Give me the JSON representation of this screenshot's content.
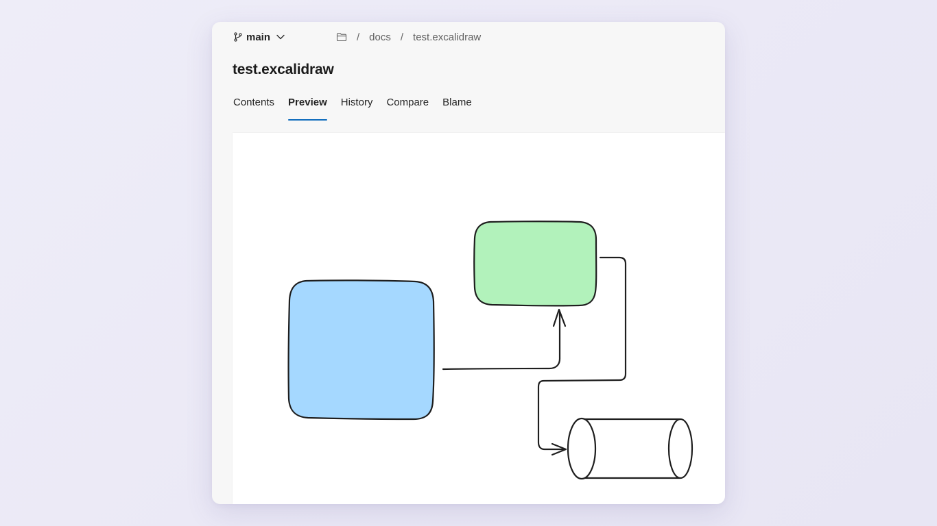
{
  "branch": {
    "name": "main"
  },
  "breadcrumb": {
    "separator": "/",
    "items": [
      "docs",
      "test.excalidraw"
    ]
  },
  "file": {
    "title": "test.excalidraw"
  },
  "tabs": [
    {
      "label": "Contents",
      "active": false
    },
    {
      "label": "Preview",
      "active": true
    },
    {
      "label": "History",
      "active": false
    },
    {
      "label": "Compare",
      "active": false
    },
    {
      "label": "Blame",
      "active": false
    }
  ],
  "colors": {
    "accent": "#0f6cbd",
    "blue_box_fill": "#a5d8ff",
    "green_box_fill": "#b2f2bb",
    "stroke": "#1e1e1e"
  },
  "icons": {
    "branch": "branch-icon",
    "chevron": "chevron-down-icon",
    "folder": "folder-icon"
  }
}
